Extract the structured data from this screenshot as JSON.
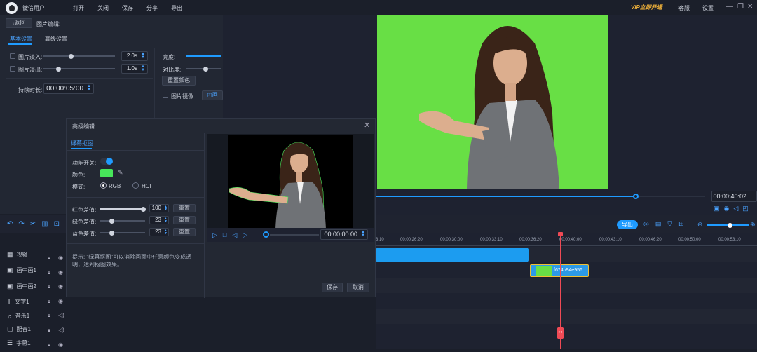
{
  "app": {
    "user": "微信用户",
    "menu": [
      "打开",
      "关闭",
      "保存",
      "分享",
      "导出"
    ],
    "vip": "VIP立即开通",
    "service": "客服",
    "settings": "设置"
  },
  "editor": {
    "back": "返回",
    "title": "图片编辑:",
    "tabs": [
      "基本设置",
      "高级设置"
    ],
    "fade_in": {
      "label": "图片淡入:",
      "value": "2.0s"
    },
    "fade_out": {
      "label": "图片淡出:",
      "value": "1.0s"
    },
    "duration": {
      "label": "持续时长:",
      "value": "00:00:05:00"
    },
    "brightness": "亮度:",
    "contrast": "对比度:",
    "reset_color": "重置颜色",
    "mirror": "图片镜像",
    "more": "画"
  },
  "dialog": {
    "title": "高级编辑",
    "tab": "绿幕抠图",
    "enable_label": "功能开关:",
    "color_label": "颜色:",
    "mode_label": "模式:",
    "modes": [
      "RGB",
      "HCI"
    ],
    "red": {
      "label": "红色差值:",
      "value": "100"
    },
    "green": {
      "label": "绿色差值:",
      "value": "23"
    },
    "blue": {
      "label": "蓝色差值:",
      "value": "23"
    },
    "reset": "重置",
    "tip": "提示: \"绿幕抠图\"可以消除画面中任意颜色变成透明，达到抠图效果。",
    "time": "00:00:00:00",
    "save": "保存",
    "cancel": "取消",
    "colors": {
      "key": "#47e65a",
      "accent": "#1f9bff"
    }
  },
  "preview": {
    "time": "00:00:40:02",
    "progress": 0.79
  },
  "timeline": {
    "export": "导出",
    "ruler": [
      "3:10",
      "00:00:26:20",
      "00:00:30:00",
      "00:00:33:10",
      "00:00:36:20",
      "00:00:40:00",
      "00:00:43:10",
      "00:00:46:20",
      "00:00:50:00",
      "00:00:53:10"
    ],
    "tracks": [
      "视频",
      "画中画1",
      "画中画2",
      "文字1",
      "音乐1",
      "配音1",
      "字幕1"
    ],
    "clip_label": "f674b94e956..."
  }
}
